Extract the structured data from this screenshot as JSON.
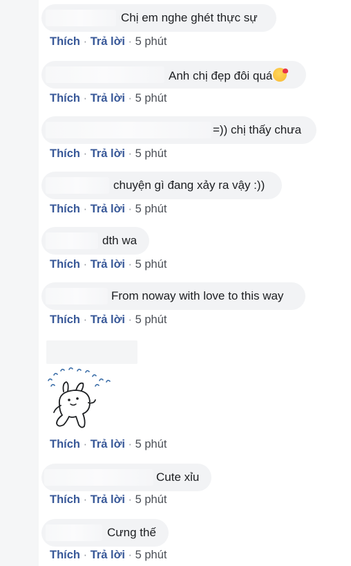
{
  "comments": [
    {
      "text": "Chị em nghe ghét thực sự"
    },
    {
      "text": "Anh chị đẹp đôi quá"
    },
    {
      "text": "=)) chị thấy chưa"
    },
    {
      "text": "chuyện gì đang xảy ra vậy :))"
    },
    {
      "text": "dth wa"
    },
    {
      "text": "From noway with love to this way"
    },
    {
      "text": ""
    },
    {
      "text": "Cute xỉu"
    },
    {
      "text": "Cưng thế"
    }
  ],
  "actions": {
    "like": "Thích",
    "reply": "Trả lời",
    "separator": "·",
    "time": "5 phút"
  },
  "icons": {
    "emoji": "smiling-face-with-hearts-icon",
    "sticker": "bunny-sticker"
  },
  "colors": {
    "bubble": "#f2f3f5",
    "link": "#385898",
    "text": "#1c1e21"
  }
}
